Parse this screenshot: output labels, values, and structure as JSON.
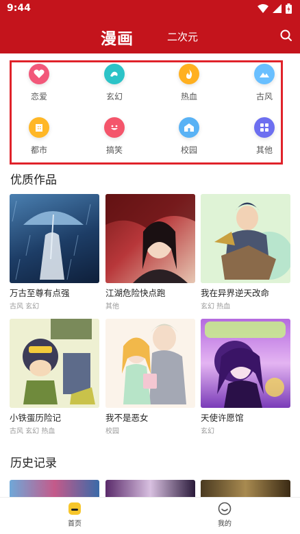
{
  "status": {
    "time": "9:44"
  },
  "appbar": {
    "tab_main": "漫画",
    "tab_sub": "二次元"
  },
  "categories": [
    {
      "label": "恋爱",
      "color": "#f2587a",
      "icon": "heart-icon"
    },
    {
      "label": "玄幻",
      "color": "#2cc3c7",
      "icon": "wave-icon"
    },
    {
      "label": "热血",
      "color": "#ffb020",
      "icon": "flame-icon"
    },
    {
      "label": "古风",
      "color": "#69bfff",
      "icon": "mountain-icon"
    },
    {
      "label": "都市",
      "color": "#ffb726",
      "icon": "building-icon"
    },
    {
      "label": "搞笑",
      "color": "#f4556b",
      "icon": "smile-icon"
    },
    {
      "label": "校园",
      "color": "#59b2f5",
      "icon": "school-icon"
    },
    {
      "label": "其他",
      "color": "#6d6ff0",
      "icon": "grid-icon"
    }
  ],
  "quality": {
    "title": "优质作品",
    "items": [
      {
        "title": "万古至尊有点强",
        "tags": "古风 玄幻"
      },
      {
        "title": "江湖危险快点跑",
        "tags": "其他"
      },
      {
        "title": "我在异界逆天改命",
        "tags": "玄幻 热血"
      },
      {
        "title": "小铁蛋历险记",
        "tags": "古风 玄幻 热血"
      },
      {
        "title": "我不是恶女",
        "tags": "校园"
      },
      {
        "title": "天使许愿馆",
        "tags": "玄幻"
      }
    ]
  },
  "history": {
    "title": "历史记录"
  },
  "bottom_nav": [
    {
      "label": "首页"
    },
    {
      "label": "我的"
    }
  ],
  "colors": {
    "brand": "#c4141c",
    "highlight_border": "#e0222a"
  }
}
